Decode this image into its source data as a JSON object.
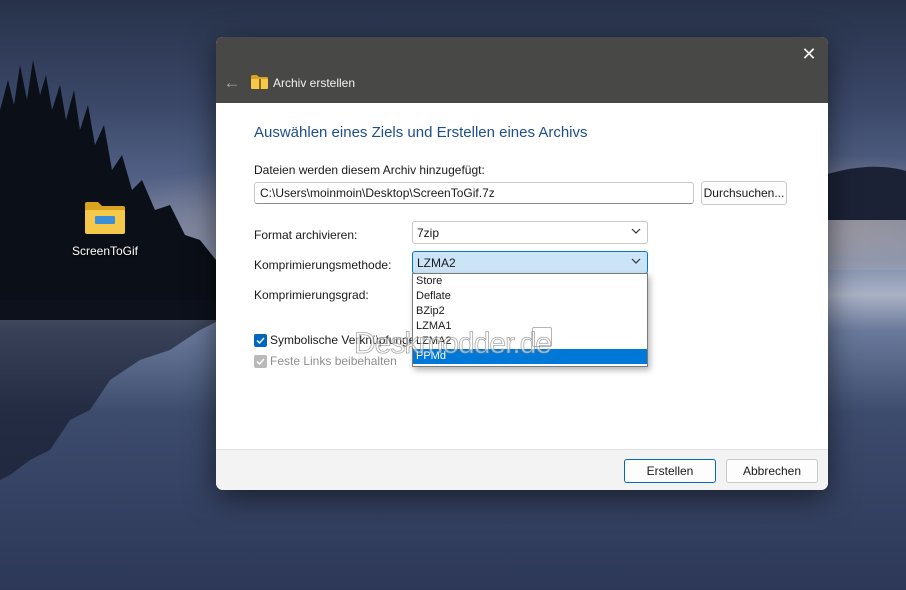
{
  "desktop": {
    "icon_label": "ScreenToGif",
    "icon": "folder-icon"
  },
  "dialog": {
    "title": "Archiv erstellen",
    "close_icon": "close-icon",
    "back_icon": "back-arrow-icon",
    "heading": "Auswählen eines Ziels und Erstellen eines Archivs",
    "files_label": "Dateien werden diesem Archiv hinzugefügt:",
    "path_value": "C:\\Users\\moinmoin\\Desktop\\ScreenToGif.7z",
    "browse_label": "Durchsuchen...",
    "format_label": "Format archivieren:",
    "format_value": "7zip",
    "method_label": "Komprimierungsmethode:",
    "method_value": "LZMA2",
    "level_label": "Komprimierungsgrad:",
    "method_options": [
      "Store",
      "Deflate",
      "BZip2",
      "LZMA1",
      "LZMA2",
      "PPMd"
    ],
    "highlighted_option": "PPMd",
    "symlink_label": "Symbolische Verknüpfungen",
    "symlink_checked": true,
    "hardlink_label": "Feste Links beibehalten",
    "hardlink_checked": true,
    "hardlink_enabled": false,
    "create_label": "Erstellen",
    "cancel_label": "Abbrechen"
  },
  "watermark": "Deskmodder.de",
  "colors": {
    "titlebar": "#484846",
    "heading": "#1f4e8c",
    "accent": "#0078d7",
    "combo_active": "#cce4f7"
  }
}
